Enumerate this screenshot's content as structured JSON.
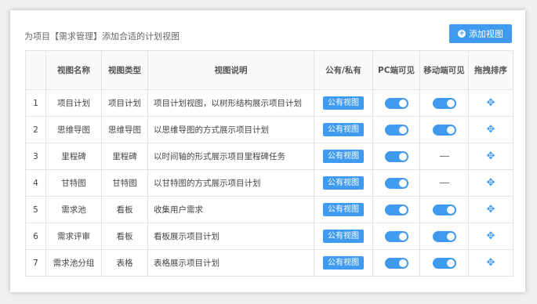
{
  "header": {
    "title": "为项目【需求管理】添加合适的计划视图",
    "add_button_label": "添加视图"
  },
  "table": {
    "columns": [
      "",
      "视图名称",
      "视图类型",
      "视图说明",
      "公有/私有",
      "PC端可见",
      "移动端可见",
      "拖拽排序"
    ],
    "rows": [
      {
        "index": "1",
        "name": "项目计划",
        "type": "项目计划",
        "desc": "项目计划视图，以树形结构展示项目计划",
        "visibility": "公有视图",
        "pc_visible": true,
        "mobile_visible": true
      },
      {
        "index": "2",
        "name": "思维导图",
        "type": "思维导图",
        "desc": "以思维导图的方式展示项目计划",
        "visibility": "公有视图",
        "pc_visible": true,
        "mobile_visible": true
      },
      {
        "index": "3",
        "name": "里程碑",
        "type": "里程碑",
        "desc": "以时间轴的形式展示项目里程碑任务",
        "visibility": "公有视图",
        "pc_visible": true,
        "mobile_visible": false
      },
      {
        "index": "4",
        "name": "甘特图",
        "type": "甘特图",
        "desc": "以甘特图的方式展示项目计划",
        "visibility": "公有视图",
        "pc_visible": true,
        "mobile_visible": false
      },
      {
        "index": "5",
        "name": "需求池",
        "type": "看板",
        "desc": "收集用户需求",
        "visibility": "公有视图",
        "pc_visible": true,
        "mobile_visible": true
      },
      {
        "index": "6",
        "name": "需求评审",
        "type": "看板",
        "desc": "看板展示项目计划",
        "visibility": "公有视图",
        "pc_visible": true,
        "mobile_visible": true
      },
      {
        "index": "7",
        "name": "需求池分组",
        "type": "表格",
        "desc": "表格展示项目计划",
        "visibility": "公有视图",
        "pc_visible": true,
        "mobile_visible": true
      }
    ]
  },
  "icons": {
    "add": "plus-circle-icon",
    "drag": "move-arrows-icon"
  },
  "colors": {
    "accent": "#3e9bf0"
  }
}
